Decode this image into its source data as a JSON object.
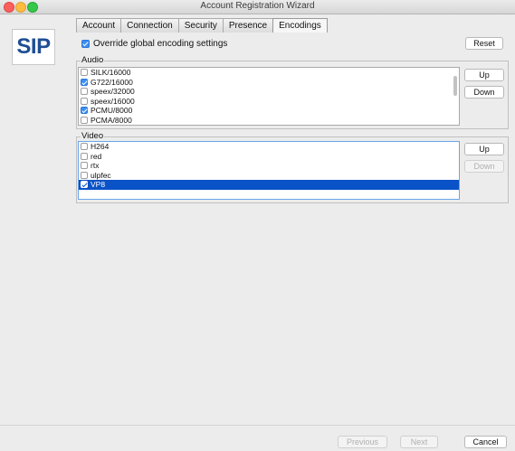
{
  "window": {
    "title": "Account Registration Wizard"
  },
  "logo": {
    "text": "SIP"
  },
  "tabs": [
    {
      "label": "Account",
      "active": false
    },
    {
      "label": "Connection",
      "active": false
    },
    {
      "label": "Security",
      "active": false
    },
    {
      "label": "Presence",
      "active": false
    },
    {
      "label": "Encodings",
      "active": true
    }
  ],
  "override": {
    "label": "Override global encoding settings",
    "checked": true
  },
  "reset_label": "Reset",
  "audio": {
    "label": "Audio",
    "items": [
      {
        "name": "SILK/16000",
        "checked": false
      },
      {
        "name": "G722/16000",
        "checked": true
      },
      {
        "name": "speex/32000",
        "checked": false
      },
      {
        "name": "speex/16000",
        "checked": false
      },
      {
        "name": "PCMU/8000",
        "checked": true
      },
      {
        "name": "PCMA/8000",
        "checked": false
      }
    ],
    "up_label": "Up",
    "down_label": "Down"
  },
  "video": {
    "label": "Video",
    "items": [
      {
        "name": "H264",
        "checked": false
      },
      {
        "name": "red",
        "checked": false
      },
      {
        "name": "rtx",
        "checked": false
      },
      {
        "name": "ulpfec",
        "checked": false
      },
      {
        "name": "VP8",
        "checked": true,
        "selected": true
      }
    ],
    "up_label": "Up",
    "down_label": "Down"
  },
  "footer": {
    "previous_label": "Previous",
    "next_label": "Next",
    "cancel_label": "Cancel"
  },
  "colors": {
    "accent": "#3b8ff1",
    "selection": "#0a52c7",
    "logo_text": "#1e4e94"
  }
}
